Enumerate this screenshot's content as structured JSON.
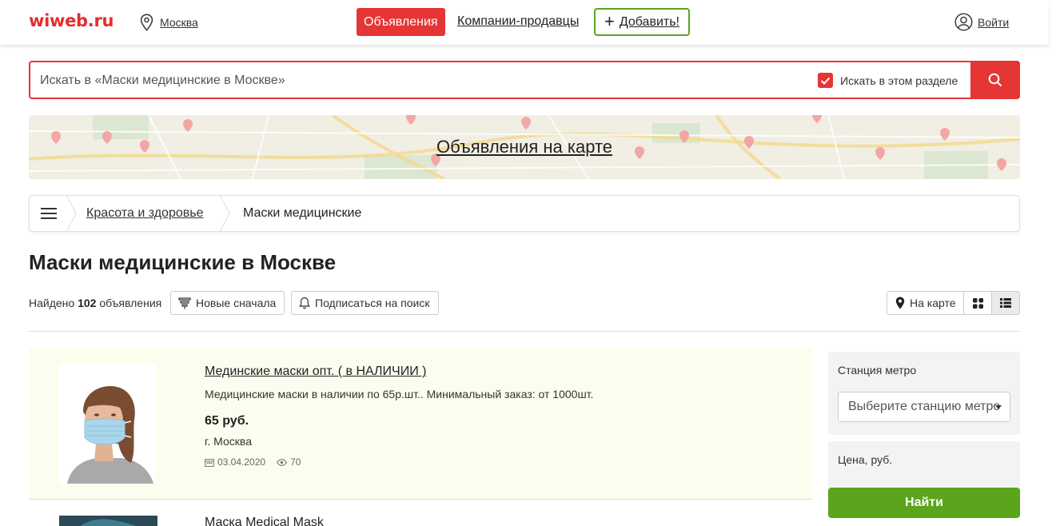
{
  "header": {
    "logo": "wiweb.ru",
    "city": "Москва",
    "nav_ads": "Объявления",
    "nav_companies": "Компании-продавцы",
    "nav_add": "Добавить!",
    "login": "Войти"
  },
  "search": {
    "placeholder": "Искать в «Маски медицинские в Москве»",
    "scope_label": "Искать в этом разделе",
    "scope_checked": true
  },
  "map_banner": {
    "title": "Объявления на карте"
  },
  "breadcrumb": {
    "items": [
      "Красота и здоровье",
      "Маски медицинские"
    ]
  },
  "page_title": "Маски медицинские в Москве",
  "toolbar": {
    "found_prefix": "Найдено",
    "found_count": "102",
    "found_suffix": "объявления",
    "sort_label": "Новые сначала",
    "subscribe_label": "Подписаться на поиск",
    "map_label": "На карте"
  },
  "listings": [
    {
      "title": "Мединские маски опт. ( в НАЛИЧИИ )",
      "description": "Медицинские маски в наличии по 65р.шт.. Минимальный заказ: от 1000шт.",
      "price": "65 руб.",
      "city": "г. Москва",
      "date": "03.04.2020",
      "views": "70"
    },
    {
      "title": "Маска Medical Mask"
    }
  ],
  "sidebar": {
    "metro_label": "Станция метро",
    "metro_placeholder": "Выберите станцию метро",
    "price_label": "Цена, руб.",
    "find_button": "Найти"
  },
  "colors": {
    "accent_red": "#e53535",
    "accent_green": "#5aa51b",
    "listing_highlight": "#fdfdef"
  }
}
